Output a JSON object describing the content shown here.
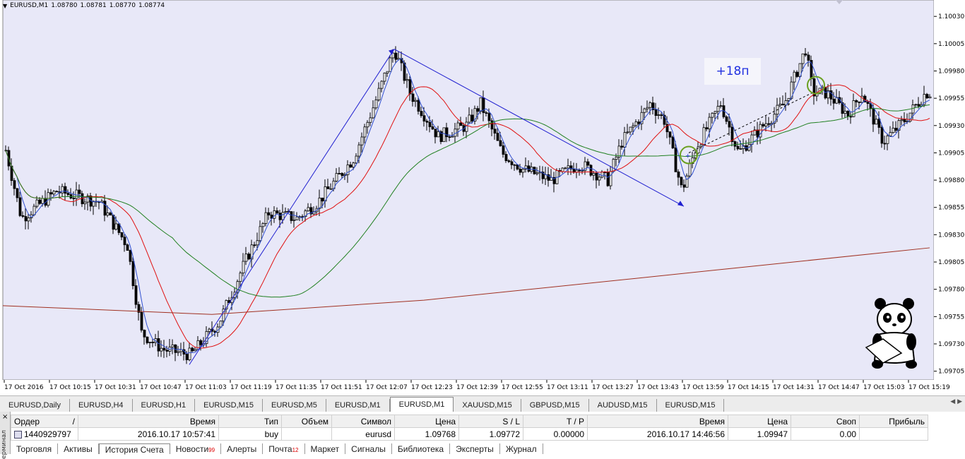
{
  "chart": {
    "symbol_header": "EURUSD,M1",
    "ohlc": [
      "1.08780",
      "1.08781",
      "1.08770",
      "1.08774"
    ],
    "pips_label": "+18п",
    "price_labels": [
      "1.10030",
      "1.10005",
      "1.09980",
      "1.09955",
      "1.09930",
      "1.09905",
      "1.09880",
      "1.09855",
      "1.09830",
      "1.09805",
      "1.09780",
      "1.09755",
      "1.09730",
      "1.09705"
    ],
    "time_labels": [
      "17 Oct 2016",
      "17 Oct 10:15",
      "17 Oct 10:31",
      "17 Oct 10:47",
      "17 Oct 11:03",
      "17 Oct 11:19",
      "17 Oct 11:35",
      "17 Oct 11:51",
      "17 Oct 12:07",
      "17 Oct 12:23",
      "17 Oct 12:39",
      "17 Oct 12:55",
      "17 Oct 13:11",
      "17 Oct 13:27",
      "17 Oct 13:43",
      "17 Oct 13:59",
      "17 Oct 14:15",
      "17 Oct 14:31",
      "17 Oct 14:47",
      "17 Oct 15:03",
      "17 Oct 15:19"
    ],
    "colors": {
      "bg": "#e8e8f8",
      "candle": "#000000",
      "ma_fast": "#3050d0",
      "ma_mid": "#e01010",
      "ma_slow": "#208020",
      "ma_long": "#a03020",
      "trend": "#2020d0",
      "circle": "#6aa020"
    },
    "key_points": [
      {
        "t": "17 Oct 11:03",
        "price": 1.09711
      },
      {
        "t": "17 Oct 12:07",
        "price": 1.1
      },
      {
        "t": "17 Oct 13:59",
        "price": 1.09856
      }
    ]
  },
  "chart_tabs": [
    "EURUSD,Daily",
    "EURUSD,H4",
    "EURUSD,H1",
    "EURUSD,M15",
    "EURUSD,M5",
    "EURUSD,M1",
    "EURUSD,M1",
    "XAUUSD,M15",
    "GBPUSD,M15",
    "AUDUSD,M15",
    "EURUSD,M15"
  ],
  "active_chart_tab": 6,
  "terminal": {
    "side_label": "ерминал",
    "headers": [
      "Ордер",
      "/",
      "Время",
      "Тип",
      "Объем",
      "Символ",
      "Цена",
      "S / L",
      "T / P",
      "Время",
      "Цена",
      "Своп",
      "Прибыль"
    ],
    "row": [
      "1440929797",
      "2016.10.17 10:57:41",
      "buy",
      "",
      "eurusd",
      "1.09768",
      "1.09772",
      "0.00000",
      "2016.10.17 14:46:56",
      "1.09947",
      "0.00",
      ""
    ],
    "tabs": [
      "Торговля",
      "Активы",
      "История Счета",
      "Новости",
      "Алерты",
      "Почта",
      "Маркет",
      "Сигналы",
      "Библиотека",
      "Эксперты",
      "Журнал"
    ],
    "tab_badges": {
      "Новости": "99",
      "Почта": "12"
    },
    "active_tab": 2
  }
}
